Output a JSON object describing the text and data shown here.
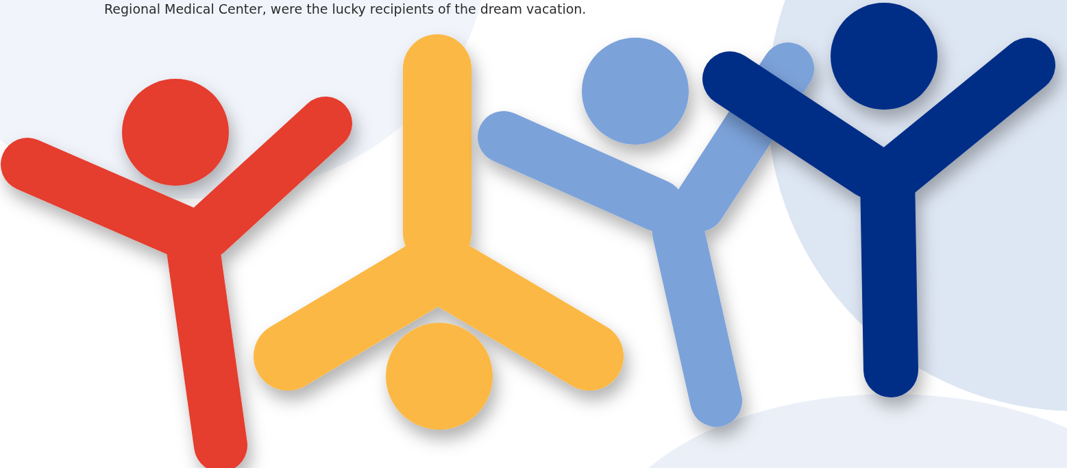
{
  "intro": {
    "text": "Regional Medical Center, were the lucky recipients of the dream vacation."
  },
  "figures": [
    {
      "color": "#e53d2f"
    },
    {
      "color": "#fbb844"
    },
    {
      "color": "#7ba2da"
    },
    {
      "color": "#002e87"
    }
  ]
}
